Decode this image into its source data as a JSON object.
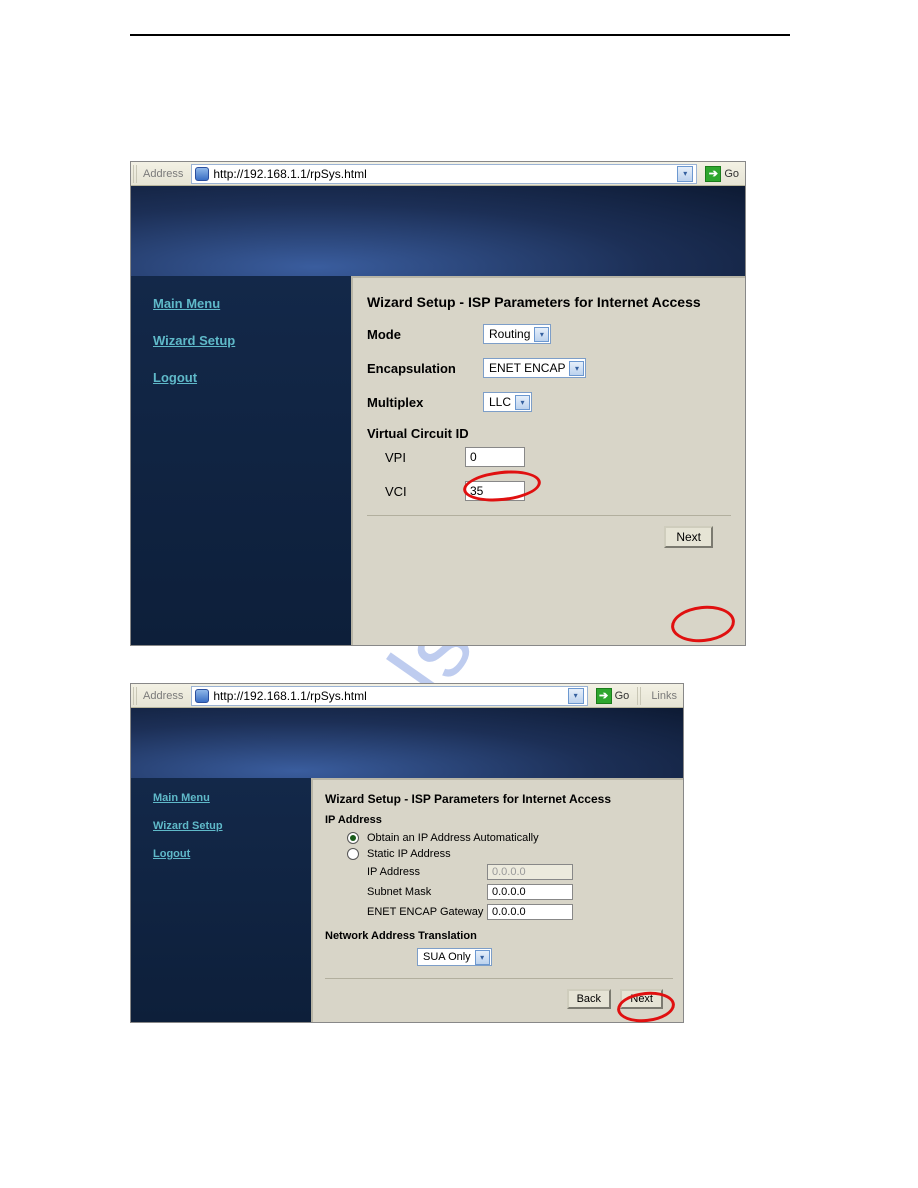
{
  "addressbar": {
    "label": "Address",
    "url": "http://192.168.1.1/rpSys.html",
    "go": "Go",
    "links": "Links"
  },
  "sidebar": {
    "main_menu": "Main Menu",
    "wizard_setup": "Wizard Setup",
    "logout": "Logout"
  },
  "panel1": {
    "title": "Wizard Setup - ISP Parameters for Internet Access",
    "mode_label": "Mode",
    "mode_value": "Routing",
    "encap_label": "Encapsulation",
    "encap_value": "ENET ENCAP",
    "mux_label": "Multiplex",
    "mux_value": "LLC",
    "vc_label": "Virtual Circuit ID",
    "vpi_label": "VPI",
    "vpi_value": "0",
    "vci_label": "VCI",
    "vci_value": "35",
    "next": "Next"
  },
  "panel2": {
    "title": "Wizard Setup - ISP Parameters for Internet Access",
    "ip_label": "IP Address",
    "opt_auto": "Obtain an IP Address Automatically",
    "opt_static": "Static IP Address",
    "ip_field": "IP Address",
    "ip_value": "0.0.0.0",
    "subnet_field": "Subnet Mask",
    "subnet_value": "0.0.0.0",
    "gw_field": "ENET ENCAP Gateway",
    "gw_value": "0.0.0.0",
    "nat_label": "Network Address Translation",
    "nat_value": "SUA Only",
    "back": "Back",
    "next": "Next"
  }
}
